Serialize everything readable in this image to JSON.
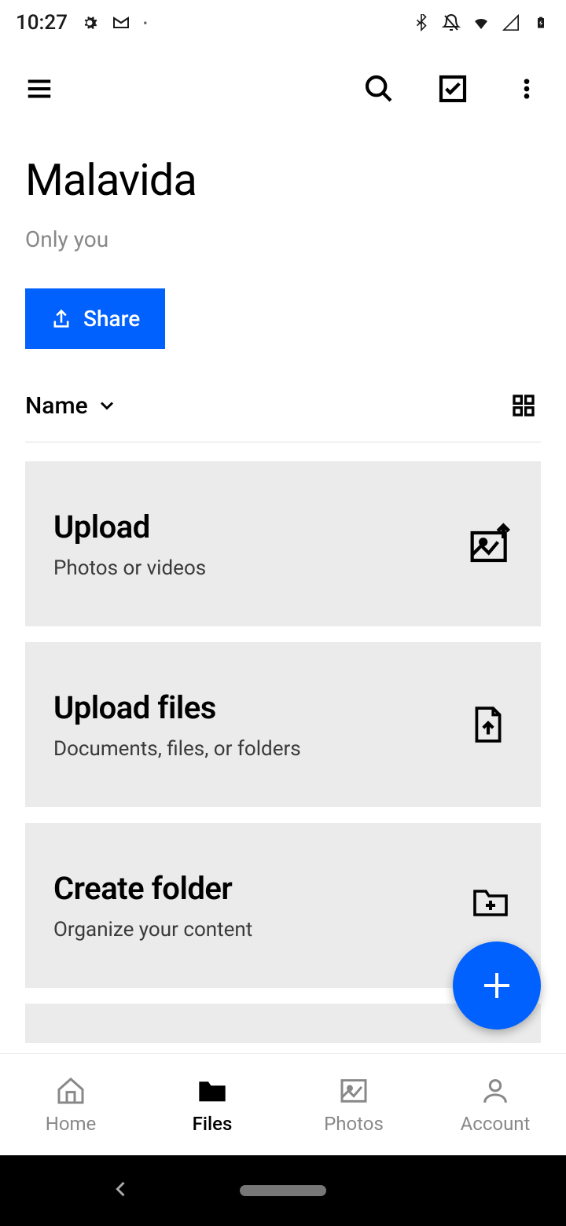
{
  "status": {
    "time": "10:27"
  },
  "folder": {
    "title": "Malavida",
    "subtitle": "Only you",
    "share_label": "Share"
  },
  "sort": {
    "label": "Name"
  },
  "cards": [
    {
      "title": "Upload",
      "desc": "Photos or videos"
    },
    {
      "title": "Upload files",
      "desc": "Documents, files, or folders"
    },
    {
      "title": "Create folder",
      "desc": "Organize your content"
    }
  ],
  "nav": [
    {
      "label": "Home"
    },
    {
      "label": "Files"
    },
    {
      "label": "Photos"
    },
    {
      "label": "Account"
    }
  ]
}
